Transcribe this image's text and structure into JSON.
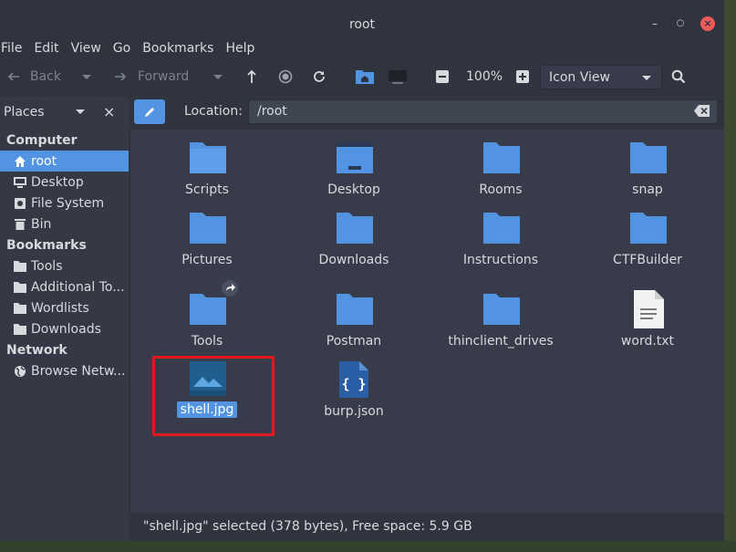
{
  "window": {
    "title": "root"
  },
  "menu": [
    "File",
    "Edit",
    "View",
    "Go",
    "Bookmarks",
    "Help"
  ],
  "toolbar": {
    "back_label": "Back",
    "forward_label": "Forward",
    "zoom": "100%",
    "view_mode": "Icon View"
  },
  "sidebar": {
    "header": "Places",
    "sections": [
      {
        "title": "Computer",
        "items": [
          {
            "label": "root",
            "icon": "home-icon",
            "selected": true
          },
          {
            "label": "Desktop",
            "icon": "desktop-icon"
          },
          {
            "label": "File System",
            "icon": "drive-icon"
          },
          {
            "label": "Bin",
            "icon": "trash-icon"
          }
        ]
      },
      {
        "title": "Bookmarks",
        "items": [
          {
            "label": "Tools",
            "icon": "folder-icon"
          },
          {
            "label": "Additional To...",
            "icon": "folder-icon"
          },
          {
            "label": "Wordlists",
            "icon": "folder-icon"
          },
          {
            "label": "Downloads",
            "icon": "folder-icon"
          }
        ]
      },
      {
        "title": "Network",
        "items": [
          {
            "label": "Browse Netw...",
            "icon": "globe-icon"
          }
        ]
      }
    ]
  },
  "location": {
    "label": "Location:",
    "path": "/root"
  },
  "files": [
    {
      "name": "Scripts",
      "type": "folder"
    },
    {
      "name": "Desktop",
      "type": "desktop-folder"
    },
    {
      "name": "Rooms",
      "type": "folder"
    },
    {
      "name": "snap",
      "type": "folder"
    },
    {
      "name": "Pictures",
      "type": "folder"
    },
    {
      "name": "Downloads",
      "type": "folder"
    },
    {
      "name": "Instructions",
      "type": "folder"
    },
    {
      "name": "CTFBuilder",
      "type": "folder"
    },
    {
      "name": "Tools",
      "type": "folder-link"
    },
    {
      "name": "Postman",
      "type": "folder"
    },
    {
      "name": "thinclient_drives",
      "type": "folder"
    },
    {
      "name": "word.txt",
      "type": "text"
    },
    {
      "name": "shell.jpg",
      "type": "image",
      "selected": true
    },
    {
      "name": "burp.json",
      "type": "json"
    }
  ],
  "status": "\"shell.jpg\" selected (378 bytes), Free space: 5.9 GB",
  "colors": {
    "accent": "#5294e2",
    "folder": "#5294e2",
    "highlight_box": "#e0191e"
  }
}
